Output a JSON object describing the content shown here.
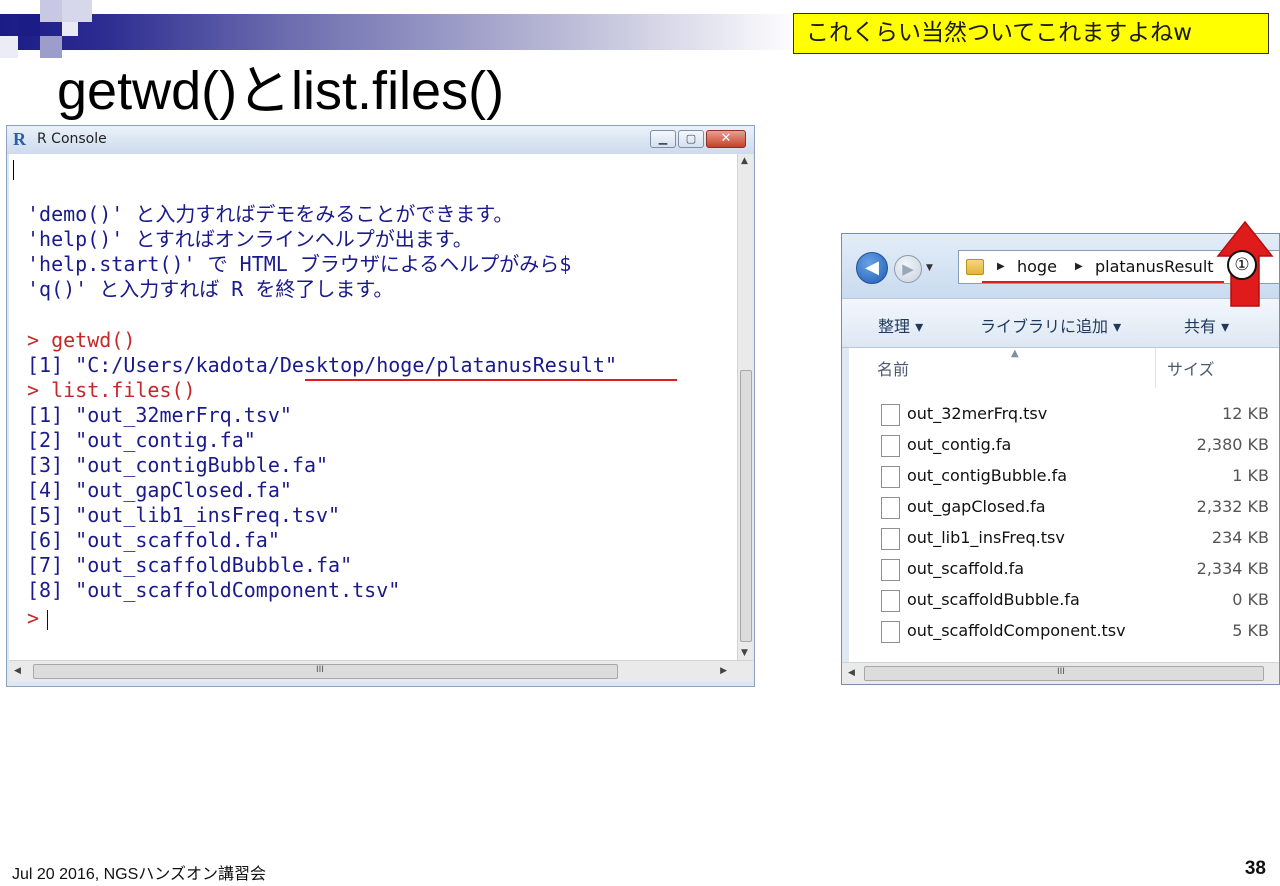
{
  "slide": {
    "title": "getwd()とlist.files()",
    "callout": "これくらい当然ついてこれますよねw",
    "footer": "Jul 20 2016, NGSハンズオン講習会",
    "page_number": "38",
    "annotation_number": "①"
  },
  "r_console": {
    "window_title": "R Console",
    "logo_letter": "R",
    "intro_lines": [
      "'demo()' と入力すればデモをみることができます。",
      "'help()' とすればオンラインヘルプが出ます。",
      "'help.start()' で HTML ブラウザによるヘルプがみら$",
      "'q()' と入力すれば R を終了します。"
    ],
    "cmd1": "> getwd()",
    "result1": "[1] \"C:/Users/kadota/Desktop/hoge/platanusResult\"",
    "cmd2": "> list.files()",
    "files": [
      "[1] \"out_32merFrq.tsv\"",
      "[2] \"out_contig.fa\"",
      "[3] \"out_contigBubble.fa\"",
      "[4] \"out_gapClosed.fa\"",
      "[5] \"out_lib1_insFreq.tsv\"",
      "[6] \"out_scaffold.fa\"",
      "[7] \"out_scaffoldBubble.fa\"",
      "[8] \"out_scaffoldComponent.tsv\""
    ],
    "prompt": ">"
  },
  "explorer": {
    "breadcrumb": [
      "hoge",
      "platanusResult"
    ],
    "toolbar": {
      "organize": "整理 ▾",
      "add_library": "ライブラリに追加 ▾",
      "share": "共有 ▾"
    },
    "columns": {
      "name": "名前",
      "size": "サイズ"
    },
    "files": [
      {
        "name": "out_32merFrq.tsv",
        "size": "12 KB"
      },
      {
        "name": "out_contig.fa",
        "size": "2,380 KB"
      },
      {
        "name": "out_contigBubble.fa",
        "size": "1 KB"
      },
      {
        "name": "out_gapClosed.fa",
        "size": "2,332 KB"
      },
      {
        "name": "out_lib1_insFreq.tsv",
        "size": "234 KB"
      },
      {
        "name": "out_scaffold.fa",
        "size": "2,334 KB"
      },
      {
        "name": "out_scaffoldBubble.fa",
        "size": "0 KB"
      },
      {
        "name": "out_scaffoldComponent.tsv",
        "size": "5 KB"
      }
    ],
    "scroll_grip": "III"
  },
  "colors": {
    "highlight_red": "#e01b1b",
    "callout_yellow": "#ffff00",
    "console_blue": "#1a1a8c",
    "console_red": "#c42828"
  }
}
